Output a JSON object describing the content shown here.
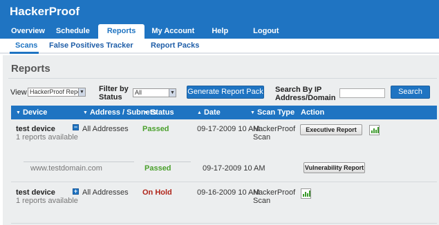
{
  "app": {
    "title": "HackerProof"
  },
  "nav": {
    "tabs": [
      "Overview",
      "Schedule",
      "Reports",
      "My Account",
      "Help",
      "Logout"
    ],
    "active": "Reports"
  },
  "subnav": {
    "items": [
      "Scans",
      "False Positives Tracker",
      "Report Packs"
    ],
    "active": "Scans"
  },
  "page": {
    "title": "Reports"
  },
  "filters": {
    "view_label": "View",
    "view_value": "HackerProof Reports",
    "status_label_1": "Filter by",
    "status_label_2": "Status",
    "status_value": "All",
    "generate_button": "Generate Report Pack",
    "search_label_1": "Search By IP",
    "search_label_2": "Address/Domain",
    "search_value": "",
    "search_button": "Search"
  },
  "table": {
    "columns": [
      "Device",
      "Address / Subnets",
      "Status",
      "Date",
      "Scan Type",
      "Action"
    ],
    "rows": [
      {
        "device": "test device",
        "reports": "1 reports available",
        "toggle": "−",
        "address": "All Addresses",
        "status": "Passed",
        "date": "09-17-2009 10 AM",
        "scan_type_1": "HackerProof",
        "scan_type_2": "Scan",
        "action": "Executive Report"
      },
      {
        "device": "test device",
        "reports": "1 reports available",
        "toggle": "+",
        "address": "All Addresses",
        "status": "On Hold",
        "date": "09-16-2009 10 AM",
        "scan_type_1": "HackerProof",
        "scan_type_2": "Scan",
        "action": ""
      }
    ],
    "sub_row": {
      "domain": "www.testdomain.com",
      "status": "Passed",
      "date": "09-17-2009 10 AM",
      "action": "Vulnerability Report"
    }
  },
  "colors": {
    "accent": "#1f74c2",
    "passed": "#4aa02c",
    "on_hold": "#b0251a",
    "content_bg": "#eceeef"
  }
}
